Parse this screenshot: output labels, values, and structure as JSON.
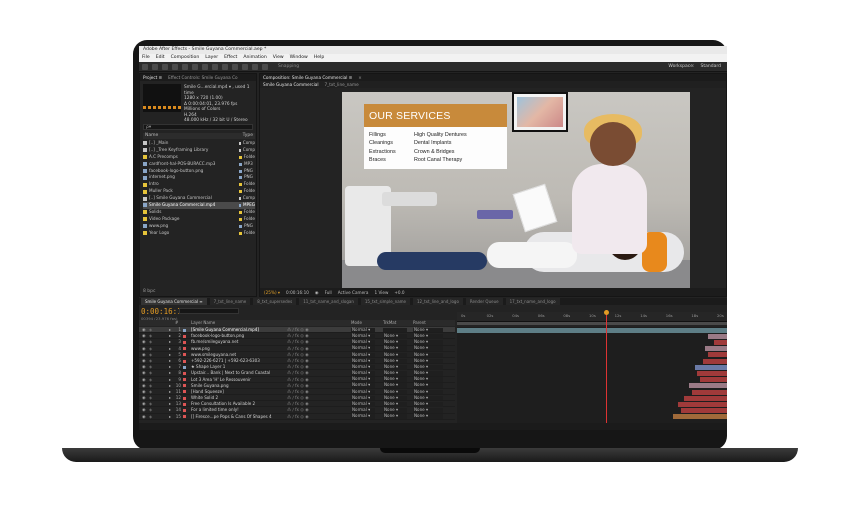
{
  "window": {
    "title": "Adobe After Effects - Smile Guyana Commercial.aep *"
  },
  "menu": [
    "File",
    "Edit",
    "Composition",
    "Layer",
    "Effect",
    "Animation",
    "View",
    "Window",
    "Help"
  ],
  "toolbar": {
    "snapping": "Snapping",
    "workspace": "Workspace:",
    "standard": "Standard"
  },
  "project_panel": {
    "tabs": [
      "Project ≡",
      "Effect Controls: Smile Guyana Co"
    ],
    "item_name": "Smile G...ercial.mp4 ▾ , used 1 time",
    "item_info": [
      "1280 x 720 (1.00)",
      "Δ 0:00:04:01, 23.976 fps",
      "Millions of Colors",
      "H.264",
      "48.000 kHz / 32 bit U / Stereo"
    ],
    "search_placeholder": "ρ▾",
    "head_name": "Name",
    "head_type": "Type",
    "rows": [
      {
        "name": "[..] _Main",
        "type": "Comp",
        "color": "#c8c8c8"
      },
      {
        "name": "[..] _Tree Keyframing Library",
        "type": "Comp",
        "color": "#c8c8c8"
      },
      {
        "name": "A.C Precomps",
        "type": "Folde",
        "color": "#e6c43a"
      },
      {
        "name": "cardfront-hal-POS-BURACC.mp3",
        "type": "MP3",
        "color": "#8aa6c8"
      },
      {
        "name": "facebook-logo-button.png",
        "type": "PNG",
        "color": "#8aa6c8"
      },
      {
        "name": "internet.png",
        "type": "PNG",
        "color": "#8aa6c8"
      },
      {
        "name": "Intro",
        "type": "Folde",
        "color": "#e6c43a"
      },
      {
        "name": "Muller Pack",
        "type": "Folde",
        "color": "#e6c43a"
      },
      {
        "name": "[..] Smile Guyana Commercial",
        "type": "Comp",
        "color": "#c8c8c8"
      },
      {
        "name": "Smile Guyana Commercial.mp4",
        "type": "MPEG",
        "color": "#8aa6c8"
      },
      {
        "name": "Solids",
        "type": "Folde",
        "color": "#e6c43a"
      },
      {
        "name": "Video Package",
        "type": "Folde",
        "color": "#e6c43a"
      },
      {
        "name": "www.png",
        "type": "PNG",
        "color": "#8aa6c8"
      },
      {
        "name": "Year Logo",
        "type": "Folde",
        "color": "#e6c43a"
      }
    ],
    "selected_row": 9,
    "footer": "8 bpc"
  },
  "composition_panel": {
    "tabs": [
      "Composition: Smile Guyana Commercial ≡",
      "×"
    ],
    "subtabs": [
      "Smile Guyana Commercial",
      "7_txt_line_name"
    ],
    "video": {
      "banner_title": "OUR SERVICES",
      "services_left": [
        "Fillings",
        "Cleanings",
        "Extractions",
        "Braces"
      ],
      "services_right": [
        "High Quality Dentures",
        "Dental Implants",
        "Crown & Bridges",
        "Root Canal Therapy"
      ],
      "banner_color": "#c88a3b"
    },
    "footer": {
      "zoom": "(25%) ▾",
      "time": "0:00:16:10",
      "quality": "Full",
      "camera": "Active Camera",
      "views": "1 View",
      "offset": "+0.0"
    }
  },
  "timeline": {
    "tabs": [
      "Smile Guyana Commercial ≡",
      "7_txt_line_name",
      "8_txt_supersedes",
      "11_txt_name_and_slogan",
      "15_txt_simple_name",
      "12_txt_line_and_logo",
      "Render Queue",
      "17_txt_name_and_logo"
    ],
    "current_time": "0:00:16:10",
    "fps": "00394 (23.976 fps)",
    "columns": {
      "num": "#",
      "name": "Layer Name",
      "mode": "Mode",
      "trkmat": "TrkMat",
      "parent": "Parent"
    },
    "ruler": [
      "0s",
      "02s",
      "04s",
      "06s",
      "08s",
      "10s",
      "12s",
      "14s",
      "16s",
      "18s",
      "20s"
    ],
    "layers": [
      {
        "num": "1",
        "name": "[Smile Guyana Commercial.mp4]",
        "label": "#8aa6c8",
        "mode": "Normal ▾",
        "trk": "",
        "par": "None ▾",
        "bar_start": 0.0,
        "bar_end": 1.0,
        "bar_color": "#5e7e86"
      },
      {
        "num": "2",
        "name": "facebook-logo-button.png",
        "label": "#d55",
        "mode": "Normal ▾",
        "trk": "None ▾",
        "par": "None ▾",
        "bar_start": 0.93,
        "bar_end": 1.0,
        "bar_color": "#9a7a86"
      },
      {
        "num": "3",
        "name": "fb.me/smileguyana.net",
        "label": "#d55",
        "mode": "Normal ▾",
        "trk": "None ▾",
        "par": "None ▾",
        "bar_start": 0.95,
        "bar_end": 1.0,
        "bar_color": "#a03a3a"
      },
      {
        "num": "4",
        "name": "www.png",
        "label": "#d55",
        "mode": "Normal ▾",
        "trk": "None ▾",
        "par": "None ▾",
        "bar_start": 0.92,
        "bar_end": 1.0,
        "bar_color": "#9a7a86"
      },
      {
        "num": "5",
        "name": "www.smileguyana.net",
        "label": "#d55",
        "mode": "Normal ▾",
        "trk": "None ▾",
        "par": "None ▾",
        "bar_start": 0.93,
        "bar_end": 1.0,
        "bar_color": "#a03a3a"
      },
      {
        "num": "6",
        "name": "+592-226-6271 | +592-623-6303",
        "label": "#d55",
        "mode": "Normal ▾",
        "trk": "None ▾",
        "par": "None ▾",
        "bar_start": 0.91,
        "bar_end": 1.0,
        "bar_color": "#a03a3a"
      },
      {
        "num": "7",
        "name": "★ Shape Layer 1",
        "label": "#8aa6c8",
        "mode": "Normal ▾",
        "trk": "None ▾",
        "par": "None ▾",
        "bar_start": 0.88,
        "bar_end": 1.0,
        "bar_color": "#6a7aa6"
      },
      {
        "num": "8",
        "name": "Upstair... Bank | Next to Grand Coastal",
        "label": "#d55",
        "mode": "Normal ▾",
        "trk": "None ▾",
        "par": "None ▾",
        "bar_start": 0.89,
        "bar_end": 1.0,
        "bar_color": "#a03a3a"
      },
      {
        "num": "9",
        "name": "Lot 3 Area 'H' Le Ressouvenir",
        "label": "#d55",
        "mode": "Normal ▾",
        "trk": "None ▾",
        "par": "None ▾",
        "bar_start": 0.9,
        "bar_end": 1.0,
        "bar_color": "#a03a3a"
      },
      {
        "num": "10",
        "name": "Smile Guyana.png",
        "label": "#d55",
        "mode": "Normal ▾",
        "trk": "None ▾",
        "par": "None ▾",
        "bar_start": 0.86,
        "bar_end": 1.0,
        "bar_color": "#9a7a86"
      },
      {
        "num": "11",
        "name": "[Hand Squeeze]",
        "label": "#d55",
        "mode": "Normal ▾",
        "trk": "None ▾",
        "par": "None ▾",
        "bar_start": 0.87,
        "bar_end": 1.0,
        "bar_color": "#a03a3a"
      },
      {
        "num": "12",
        "name": "White Solid 2",
        "label": "#d55",
        "mode": "Normal ▾",
        "trk": "None ▾",
        "par": "None ▾",
        "bar_start": 0.84,
        "bar_end": 1.0,
        "bar_color": "#a03a3a"
      },
      {
        "num": "13",
        "name": "Free Consultation Is Available 2",
        "label": "#d55",
        "mode": "Normal ▾",
        "trk": "None ▾",
        "par": "None ▾",
        "bar_start": 0.82,
        "bar_end": 1.0,
        "bar_color": "#a03a3a"
      },
      {
        "num": "14",
        "name": "For a limited time only!",
        "label": "#d55",
        "mode": "Normal ▾",
        "trk": "None ▾",
        "par": "None ▾",
        "bar_start": 0.83,
        "bar_end": 1.0,
        "bar_color": "#a03a3a"
      },
      {
        "num": "15",
        "name": "[] Firesce...pe Pops & Cans Of Shapes 4",
        "label": "#d55",
        "mode": "Normal ▾",
        "trk": "None ▾",
        "par": "None ▾",
        "bar_start": 0.8,
        "bar_end": 1.0,
        "bar_color": "#a06a3a"
      }
    ],
    "selected_layer": 0,
    "cti_position": 0.55
  }
}
